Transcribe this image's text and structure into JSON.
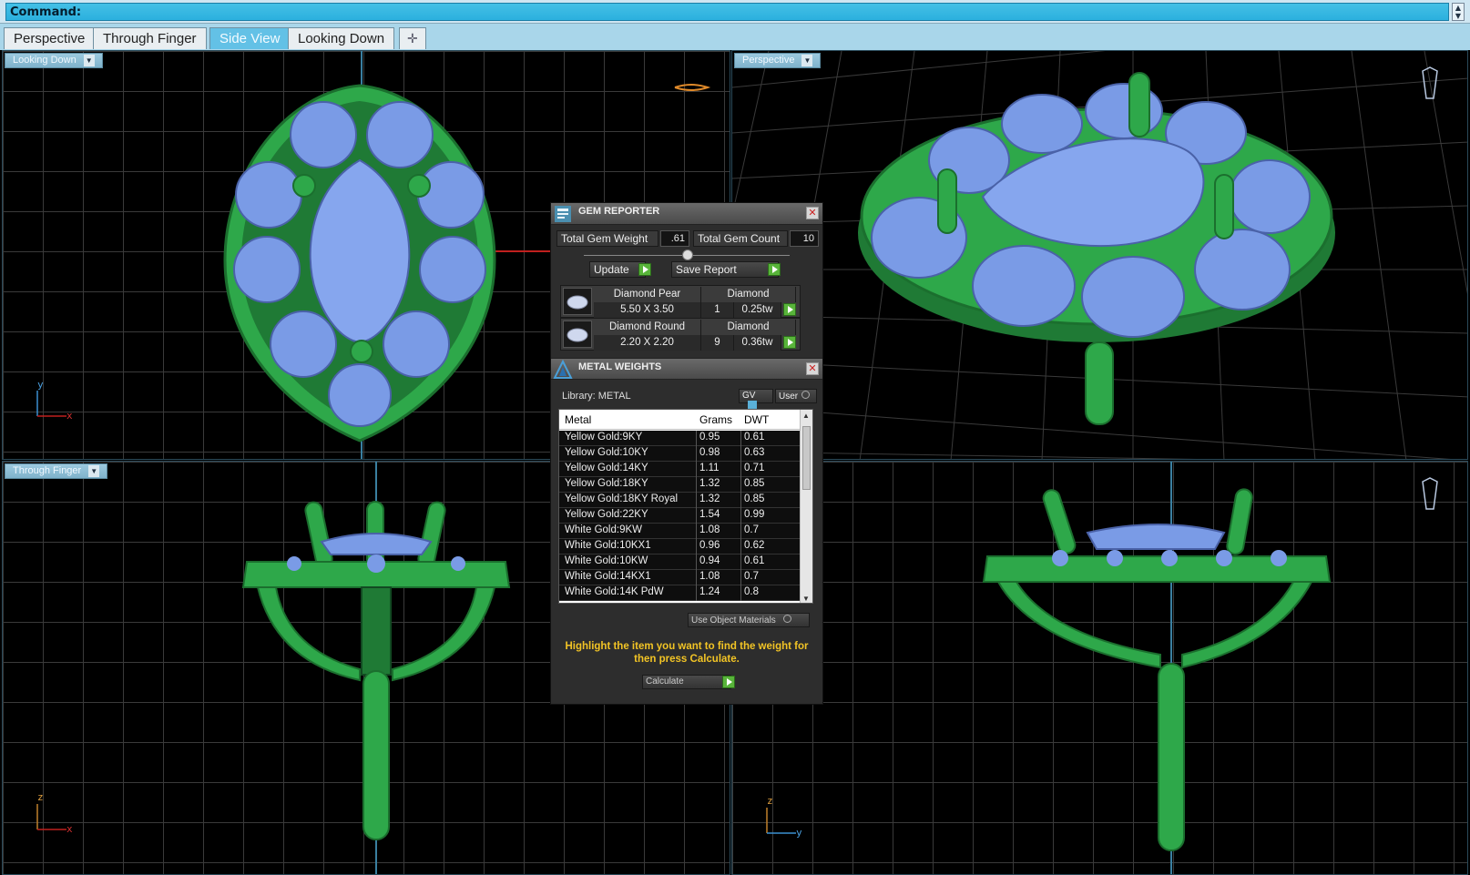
{
  "command": {
    "label": "Command:"
  },
  "tabs": [
    {
      "label": "Perspective",
      "active": false
    },
    {
      "label": "Through Finger",
      "active": false
    },
    {
      "label": "Side View",
      "active": true
    },
    {
      "label": "Looking Down",
      "active": false
    }
  ],
  "add_tab_icon": "plus-icon",
  "viewports": {
    "top_left": {
      "label": "Looking Down",
      "axis_v": "y",
      "axis_h": "x"
    },
    "top_right": {
      "label": "Perspective"
    },
    "bottom_left": {
      "label": "Through Finger",
      "axis_v": "z",
      "axis_h": "x"
    },
    "bottom_right": {
      "axis_v": "z",
      "axis_h": "y"
    }
  },
  "gem_reporter": {
    "title": "GEM REPORTER",
    "total_weight_label": "Total Gem Weight",
    "total_weight_value": ".61",
    "total_count_label": "Total Gem Count",
    "total_count_value": "10",
    "update_label": "Update",
    "save_report_label": "Save Report",
    "gems": [
      {
        "shape": "Diamond Pear",
        "material": "Diamond",
        "size": "5.50 X 3.50",
        "count": "1",
        "weight": "0.25tw"
      },
      {
        "shape": "Diamond Round",
        "material": "Diamond",
        "size": "2.20 X 2.20",
        "count": "9",
        "weight": "0.36tw"
      }
    ]
  },
  "metal_weights": {
    "title": "METAL WEIGHTS",
    "library_label": "Library: METAL",
    "gv_label": "GV",
    "user_label": "User",
    "columns": [
      "Metal",
      "Grams",
      "DWT"
    ],
    "rows": [
      {
        "metal": "Yellow Gold:9KY",
        "grams": "0.95",
        "dwt": "0.61"
      },
      {
        "metal": "Yellow Gold:10KY",
        "grams": "0.98",
        "dwt": "0.63"
      },
      {
        "metal": "Yellow Gold:14KY",
        "grams": "1.11",
        "dwt": "0.71"
      },
      {
        "metal": "Yellow Gold:18KY",
        "grams": "1.32",
        "dwt": "0.85"
      },
      {
        "metal": "Yellow Gold:18KY Royal",
        "grams": "1.32",
        "dwt": "0.85"
      },
      {
        "metal": "Yellow Gold:22KY",
        "grams": "1.54",
        "dwt": "0.99"
      },
      {
        "metal": "White Gold:9KW",
        "grams": "1.08",
        "dwt": "0.7"
      },
      {
        "metal": "White Gold:10KX1",
        "grams": "0.96",
        "dwt": "0.62"
      },
      {
        "metal": "White Gold:10KW",
        "grams": "0.94",
        "dwt": "0.61"
      },
      {
        "metal": "White Gold:14KX1",
        "grams": "1.08",
        "dwt": "0.7"
      },
      {
        "metal": "White Gold:14K PdW",
        "grams": "1.24",
        "dwt": "0.8"
      }
    ],
    "use_object_materials_label": "Use Object Materials",
    "hint": "Highlight the item you want to find the weight for then press Calculate.",
    "calculate_label": "Calculate"
  },
  "colors": {
    "metal_green": "#2ea84a",
    "gem_blue": "#7a9be6",
    "command_bar": "#2bb0de",
    "hint_yellow": "#f2c425"
  }
}
